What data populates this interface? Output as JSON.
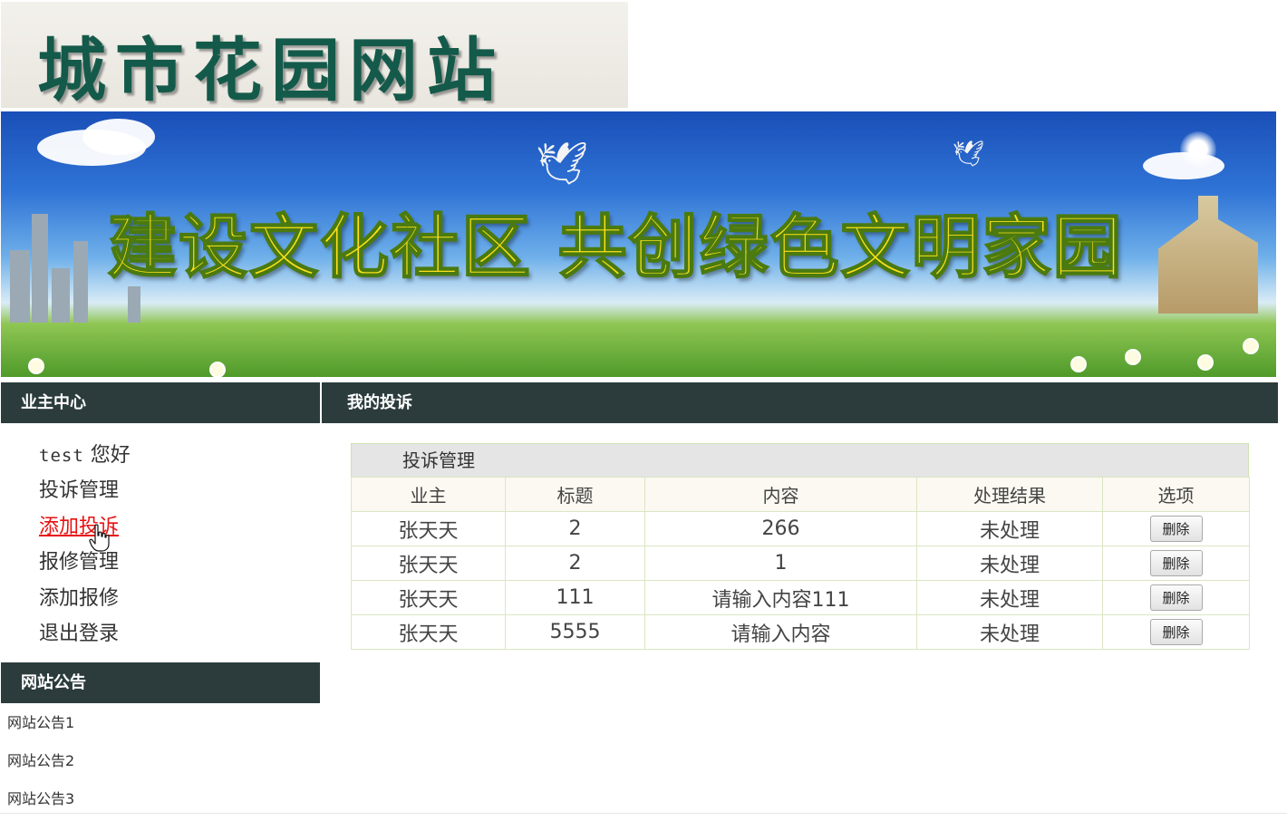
{
  "logo": {
    "text": "城市花园网站"
  },
  "banner": {
    "slogan": "建设文化社区 共创绿色文明家园"
  },
  "sidebar": {
    "title": "业主中心",
    "greeting": {
      "username": "test",
      "suffix": " 您好"
    },
    "items": [
      {
        "label": "投诉管理",
        "active": false
      },
      {
        "label": "添加投诉",
        "active": true
      },
      {
        "label": "报修管理",
        "active": false
      },
      {
        "label": "添加报修",
        "active": false
      },
      {
        "label": "退出登录",
        "active": false
      }
    ]
  },
  "notices": {
    "title": "网站公告",
    "items": [
      "网站公告1",
      "网站公告2",
      "网站公告3"
    ]
  },
  "main": {
    "title": "我的投诉",
    "panel_title": "投诉管理",
    "columns": [
      "业主",
      "标题",
      "内容",
      "处理结果",
      "选项"
    ],
    "rows": [
      {
        "owner": "张天天",
        "title": "2",
        "content": "266",
        "status": "未处理",
        "action": "删除"
      },
      {
        "owner": "张天天",
        "title": "2",
        "content": "1",
        "status": "未处理",
        "action": "删除"
      },
      {
        "owner": "张天天",
        "title": "111",
        "content": "请输入内容111",
        "status": "未处理",
        "action": "删除"
      },
      {
        "owner": "张天天",
        "title": "5555",
        "content": "请输入内容",
        "status": "未处理",
        "action": "删除"
      }
    ]
  },
  "colors": {
    "header_bg": "#2c3c3d",
    "active_link": "#e81010",
    "table_border": "#dbe6c4",
    "logo_text": "#145a4a",
    "slogan": "#ffe21a"
  },
  "cursor": {
    "icon": "hand-pointer-icon"
  }
}
